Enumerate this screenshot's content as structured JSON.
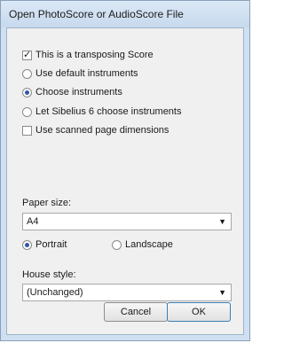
{
  "window": {
    "title": "Open PhotoScore or AudioScore File"
  },
  "options": {
    "transposing": {
      "label": "This is a transposing Score",
      "checked": true
    },
    "use_default": {
      "label": "Use default instruments",
      "selected": false
    },
    "choose": {
      "label": "Choose instruments",
      "selected": true
    },
    "let_sibelius": {
      "label": "Let Sibelius 6 choose instruments",
      "selected": false
    },
    "scanned_dims": {
      "label": "Use scanned page dimensions",
      "checked": false
    }
  },
  "paper": {
    "label": "Paper size:",
    "value": "A4",
    "orientation": {
      "portrait": "Portrait",
      "landscape": "Landscape",
      "selected": "Portrait"
    }
  },
  "house_style": {
    "label": "House style:",
    "value": "(Unchanged)"
  },
  "buttons": {
    "cancel": "Cancel",
    "ok": "OK"
  },
  "icons": {
    "dropdown": "chevron-down-icon"
  }
}
